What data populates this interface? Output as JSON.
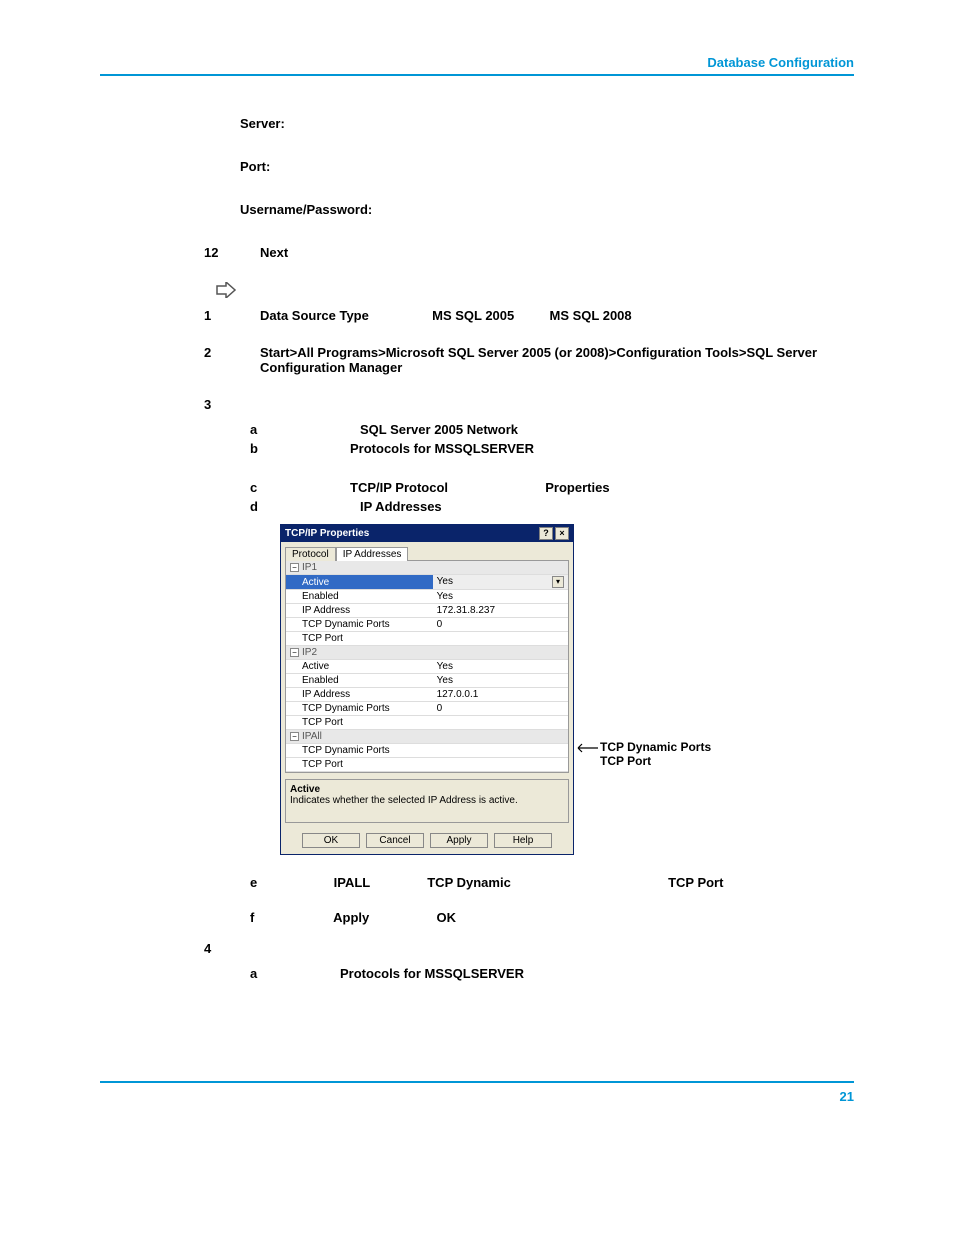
{
  "header": {
    "link": "Database Configuration"
  },
  "labels": {
    "server": "Server:",
    "port": "Port:",
    "userpass": "Username/Password:"
  },
  "step12": {
    "num": "12",
    "text": "Next"
  },
  "step1": {
    "num": "1",
    "a": "Data Source Type",
    "b": "MS SQL 2005",
    "c": "MS SQL 2008"
  },
  "step2": {
    "num": "2",
    "text": "Start>All Programs>Microsoft SQL Server 2005 (or 2008)>Configuration Tools>SQL Server Configuration Manager"
  },
  "step3": {
    "num": "3"
  },
  "sub_a": {
    "l": "a",
    "t": "SQL Server 2005 Network"
  },
  "sub_b": {
    "l": "b",
    "t": "Protocols for MSSQLSERVER"
  },
  "sub_c": {
    "l": "c",
    "t1": "TCP/IP Protocol",
    "t2": "Properties"
  },
  "sub_d": {
    "l": "d",
    "t": "IP Addresses"
  },
  "sub_e": {
    "l": "e",
    "t1": "IPALL",
    "t2": "TCP Dynamic",
    "t3": "TCP Port"
  },
  "sub_f": {
    "l": "f",
    "t1": "Apply",
    "t2": "OK"
  },
  "step4": {
    "num": "4"
  },
  "sub4a": {
    "l": "a",
    "t": "Protocols for MSSQLSERVER"
  },
  "callout": {
    "line1": "TCP Dynamic Ports",
    "line2": "TCP Port"
  },
  "dialog": {
    "title": "TCP/IP Properties",
    "help_btn": "?",
    "close_btn": "×",
    "tabs": {
      "protocol": "Protocol",
      "ip": "IP Addresses"
    },
    "sections": {
      "ip1": {
        "name": "IP1",
        "rows": [
          [
            "Active",
            "Yes"
          ],
          [
            "Enabled",
            "Yes"
          ],
          [
            "IP Address",
            "172.31.8.237"
          ],
          [
            "TCP Dynamic Ports",
            "0"
          ],
          [
            "TCP Port",
            ""
          ]
        ]
      },
      "ip2": {
        "name": "IP2",
        "rows": [
          [
            "Active",
            "Yes"
          ],
          [
            "Enabled",
            "Yes"
          ],
          [
            "IP Address",
            "127.0.0.1"
          ],
          [
            "TCP Dynamic Ports",
            "0"
          ],
          [
            "TCP Port",
            ""
          ]
        ]
      },
      "ipall": {
        "name": "IPAll",
        "rows": [
          [
            "TCP Dynamic Ports",
            ""
          ],
          [
            "TCP Port",
            ""
          ]
        ]
      }
    },
    "desc": {
      "title": "Active",
      "text": "Indicates whether the selected IP Address is active."
    },
    "buttons": {
      "ok": "OK",
      "cancel": "Cancel",
      "apply": "Apply",
      "help": "Help"
    }
  },
  "footer": {
    "page": "21"
  }
}
